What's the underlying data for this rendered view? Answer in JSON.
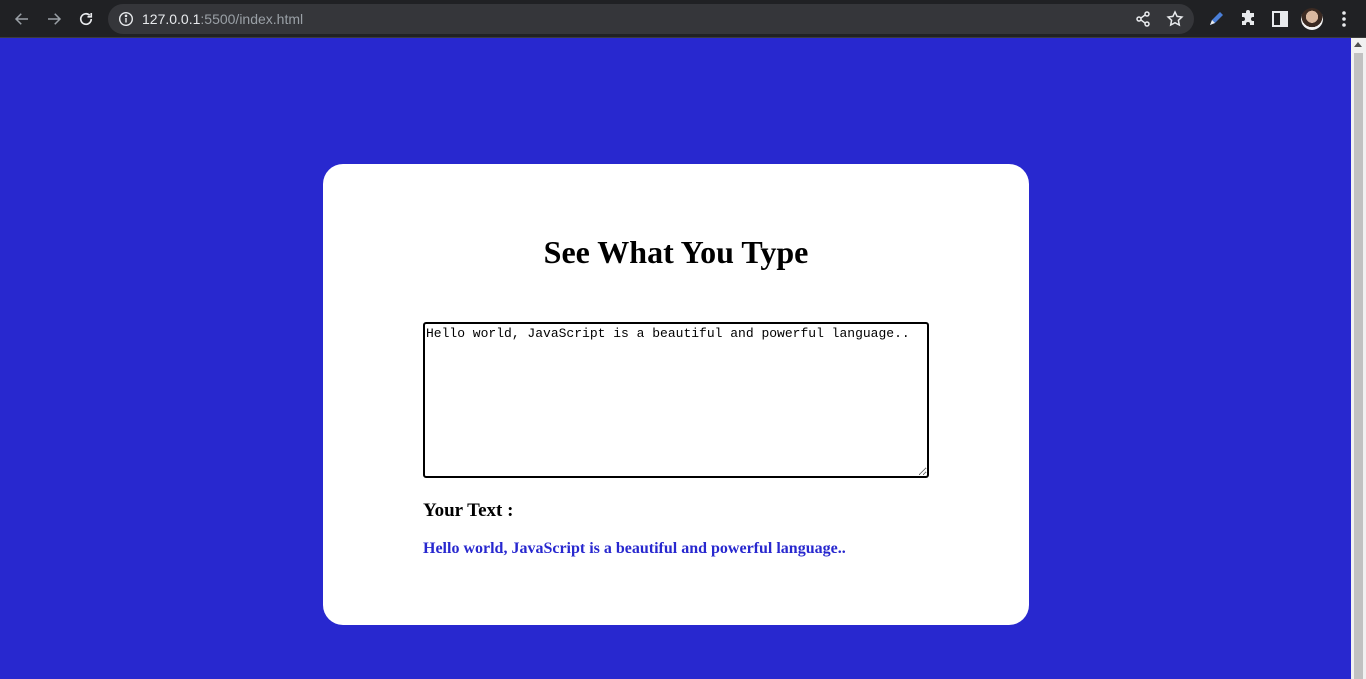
{
  "browser": {
    "url_host": "127.0.0.1",
    "url_path": ":5500/index.html"
  },
  "page": {
    "title": "See What You Type",
    "textarea_value": "Hello world, JavaScript is a beautiful and powerful language..",
    "your_text_label": "Your Text :",
    "output_text": "Hello world, JavaScript is a beautiful and powerful language.."
  },
  "colors": {
    "background": "#2828cf",
    "card": "#ffffff",
    "output_text": "#2828cf"
  }
}
